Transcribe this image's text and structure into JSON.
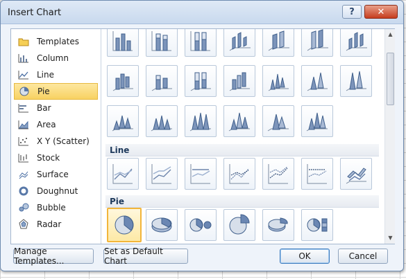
{
  "dialog": {
    "title": "Insert Chart"
  },
  "titlebar": {
    "help": "?",
    "close": "✕"
  },
  "chart_types": [
    {
      "label": "Templates",
      "icon": "folder-icon"
    },
    {
      "label": "Column",
      "icon": "column-chart-icon"
    },
    {
      "label": "Line",
      "icon": "line-chart-icon"
    },
    {
      "label": "Pie",
      "icon": "pie-chart-icon",
      "selected": true
    },
    {
      "label": "Bar",
      "icon": "bar-chart-icon"
    },
    {
      "label": "Area",
      "icon": "area-chart-icon"
    },
    {
      "label": "X Y (Scatter)",
      "icon": "scatter-chart-icon"
    },
    {
      "label": "Stock",
      "icon": "stock-chart-icon"
    },
    {
      "label": "Surface",
      "icon": "surface-chart-icon"
    },
    {
      "label": "Doughnut",
      "icon": "doughnut-chart-icon"
    },
    {
      "label": "Bubble",
      "icon": "bubble-chart-icon"
    },
    {
      "label": "Radar",
      "icon": "radar-chart-icon"
    }
  ],
  "sections": {
    "line": "Line",
    "pie": "Pie"
  },
  "buttons": {
    "manage_templates": "Manage Templates...",
    "set_default": "Set as Default Chart",
    "ok": "OK",
    "cancel": "Cancel"
  }
}
